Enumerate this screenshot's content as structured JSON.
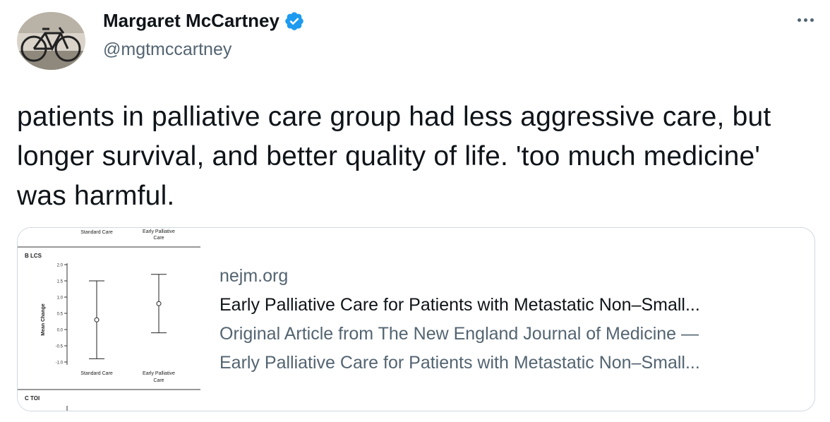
{
  "author": {
    "display_name": "Margaret McCartney",
    "handle": "@mgtmccartney",
    "avatar_icon": "bicycle-avatar",
    "verified_icon": "verified-badge-icon",
    "verified_color": "#1d9bf0"
  },
  "tweet": {
    "text": "patients in palliative care group had less aggressive care, but longer survival, and better quality of life. 'too much medicine' was harmful."
  },
  "card": {
    "domain": "nejm.org",
    "title": "Early Palliative Care for Patients with Metastatic Non–Small...",
    "description_line1": "Original Article from The New England Journal of Medicine —",
    "description_line2": "Early Palliative Care for Patients with Metastatic Non–Small...",
    "thumbnail": {
      "top_label_left": "Standard Care",
      "top_label_right_1": "Early Palliative",
      "top_label_right_2": "Care",
      "panel_b_label": "B LCS",
      "panel_c_label": "C TOI",
      "ylabel": "Mean Change",
      "xlabel_left": "Standard Care",
      "xlabel_right_1": "Early Palliative",
      "xlabel_right_2": "Care",
      "ticks": [
        "2.0",
        "1.5",
        "1.0",
        "0.5",
        "0.0",
        "-0.5",
        "-1.0"
      ]
    }
  },
  "chart_data": {
    "type": "scatter",
    "categories": [
      "Standard Care",
      "Early Palliative Care"
    ],
    "ylabel": "Mean Change",
    "ylim": [
      -1.0,
      2.0
    ],
    "series": [
      {
        "values": [
          0.3,
          0.8
        ],
        "error_low": [
          -0.9,
          -0.1
        ],
        "error_high": [
          1.5,
          1.7
        ]
      }
    ]
  },
  "colors": {
    "text": "#0f1419",
    "secondary": "#536471",
    "border": "#cfd9de"
  }
}
